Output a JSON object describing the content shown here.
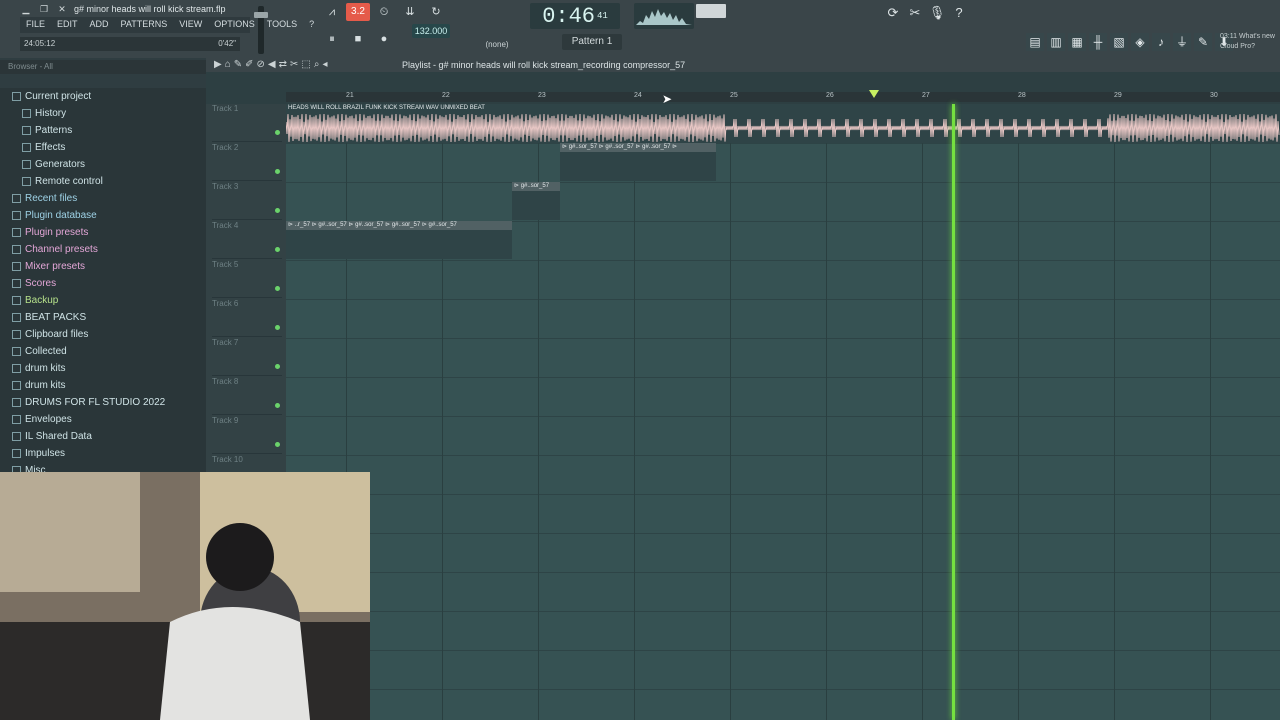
{
  "window": {
    "title": "g# minor heads will roll kick stream.flp",
    "elapsed_left": "24:05:12",
    "elapsed_right": "0'42\""
  },
  "menu": [
    "FILE",
    "EDIT",
    "ADD",
    "PATTERNS",
    "VIEW",
    "OPTIONS",
    "TOOLS",
    "?"
  ],
  "transport": {
    "tempo": "132.000",
    "time": "0:46",
    "time_small": "41",
    "time_label": "M:S:CS",
    "pattern": "Pattern 1",
    "none_label": "(none)",
    "rec_label": "3.2"
  },
  "news": {
    "line1": "03:11  What's new",
    "line2": "Cloud Pro?"
  },
  "browser": {
    "header": "Browser - All",
    "items": [
      {
        "label": "Current project",
        "style": "normal"
      },
      {
        "label": "History",
        "style": "sub"
      },
      {
        "label": "Patterns",
        "style": "sub"
      },
      {
        "label": "Effects",
        "style": "sub"
      },
      {
        "label": "Generators",
        "style": "sub"
      },
      {
        "label": "Remote control",
        "style": "sub"
      },
      {
        "label": "Recent files",
        "style": "accent"
      },
      {
        "label": "Plugin database",
        "style": "accent"
      },
      {
        "label": "Plugin presets",
        "style": "pink"
      },
      {
        "label": "Channel presets",
        "style": "pink"
      },
      {
        "label": "Mixer presets",
        "style": "pink"
      },
      {
        "label": "Scores",
        "style": "pink"
      },
      {
        "label": "Backup",
        "style": "green"
      },
      {
        "label": "BEAT PACKS",
        "style": "normal"
      },
      {
        "label": "Clipboard files",
        "style": "normal"
      },
      {
        "label": "Collected",
        "style": "normal"
      },
      {
        "label": "drum kits",
        "style": "normal"
      },
      {
        "label": "drum kits",
        "style": "normal"
      },
      {
        "label": "DRUMS FOR FL STUDIO 2022",
        "style": "normal"
      },
      {
        "label": "Envelopes",
        "style": "normal"
      },
      {
        "label": "IL Shared Data",
        "style": "normal"
      },
      {
        "label": "Impulses",
        "style": "normal"
      },
      {
        "label": "Misc",
        "style": "normal"
      }
    ]
  },
  "playlist": {
    "title": "Playlist - g# minor heads will roll kick stream_recording compressor_57",
    "ruler": [
      "21",
      "22",
      "23",
      "24",
      "25",
      "26",
      "27",
      "28",
      "29",
      "30"
    ],
    "tracks": [
      "Track 1",
      "Track 2",
      "Track 3",
      "Track 4",
      "Track 5",
      "Track 6",
      "Track 7",
      "Track 8",
      "Track 9",
      "Track 10"
    ],
    "clips": {
      "track1": "HEADS WILL ROLL BRAZIL FUNK KICK STREAM WAV UNMIXED BEAT",
      "track2": "⊳ g#..sor_57 ⊳ g#..sor_57 ⊳ g#..sor_57 ⊳",
      "track3": "⊳ g#..sor_57",
      "track4": "⊳ ..r_57 ⊳ g#..sor_57 ⊳ g#..sor_57 ⊳ g#..sor_57 ⊳ g#..sor_57"
    }
  }
}
